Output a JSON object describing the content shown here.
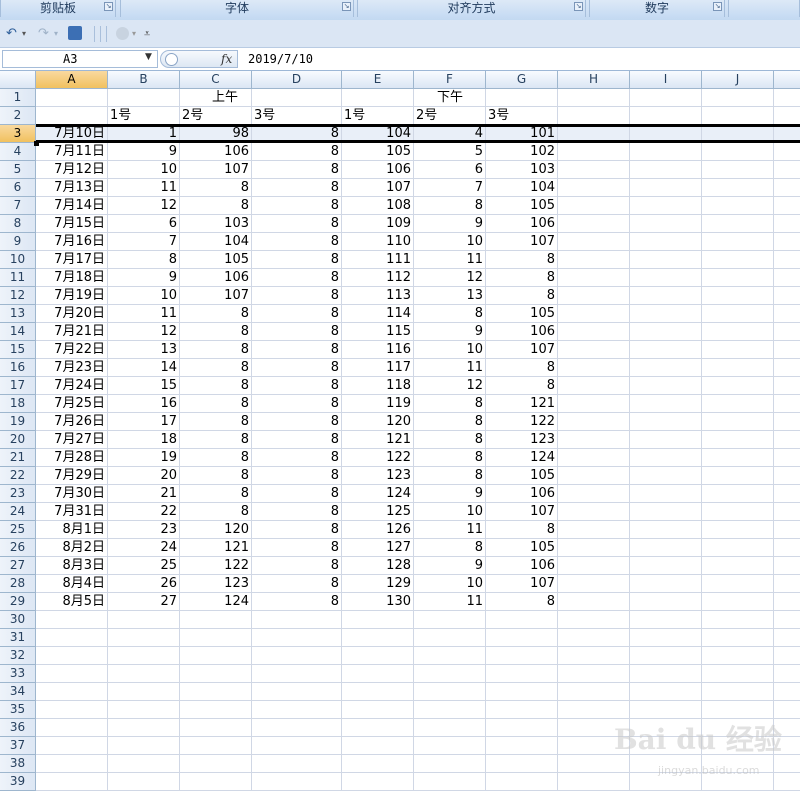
{
  "ribbon": {
    "groups": [
      {
        "label": "剪贴板"
      },
      {
        "label": "字体"
      },
      {
        "label": "对齐方式"
      },
      {
        "label": "数字"
      }
    ]
  },
  "qat": {
    "undo_icon": "undo-icon",
    "redo_icon": "redo-icon",
    "save_icon": "save-icon",
    "customize_icon": "customize-qat-icon"
  },
  "formula_bar": {
    "name_box": "A3",
    "fx_label": "fx",
    "content": "2019/7/10"
  },
  "columns": [
    "A",
    "B",
    "C",
    "D",
    "E",
    "F",
    "G",
    "H",
    "I",
    "J"
  ],
  "selected_column": "A",
  "selected_row": "3",
  "rows": [
    "1",
    "2",
    "3",
    "4",
    "5",
    "6",
    "7",
    "8",
    "9",
    "10",
    "11",
    "12",
    "13",
    "14",
    "15",
    "16",
    "17",
    "18",
    "19",
    "20",
    "21",
    "22",
    "23",
    "24",
    "25",
    "26",
    "27",
    "28",
    "29",
    "30",
    "31",
    "32",
    "33",
    "34",
    "35",
    "36",
    "37",
    "38",
    "39"
  ],
  "header": {
    "am": "上午",
    "pm": "下午",
    "sub": [
      "1号",
      "2号",
      "3号",
      "1号",
      "2号",
      "3号"
    ]
  },
  "table": [
    [
      "7月10日",
      "1",
      "98",
      "8",
      "104",
      "4",
      "101"
    ],
    [
      "7月11日",
      "9",
      "106",
      "8",
      "105",
      "5",
      "102"
    ],
    [
      "7月12日",
      "10",
      "107",
      "8",
      "106",
      "6",
      "103"
    ],
    [
      "7月13日",
      "11",
      "8",
      "8",
      "107",
      "7",
      "104"
    ],
    [
      "7月14日",
      "12",
      "8",
      "8",
      "108",
      "8",
      "105"
    ],
    [
      "7月15日",
      "6",
      "103",
      "8",
      "109",
      "9",
      "106"
    ],
    [
      "7月16日",
      "7",
      "104",
      "8",
      "110",
      "10",
      "107"
    ],
    [
      "7月17日",
      "8",
      "105",
      "8",
      "111",
      "11",
      "8"
    ],
    [
      "7月18日",
      "9",
      "106",
      "8",
      "112",
      "12",
      "8"
    ],
    [
      "7月19日",
      "10",
      "107",
      "8",
      "113",
      "13",
      "8"
    ],
    [
      "7月20日",
      "11",
      "8",
      "8",
      "114",
      "8",
      "105"
    ],
    [
      "7月21日",
      "12",
      "8",
      "8",
      "115",
      "9",
      "106"
    ],
    [
      "7月22日",
      "13",
      "8",
      "8",
      "116",
      "10",
      "107"
    ],
    [
      "7月23日",
      "14",
      "8",
      "8",
      "117",
      "11",
      "8"
    ],
    [
      "7月24日",
      "15",
      "8",
      "8",
      "118",
      "12",
      "8"
    ],
    [
      "7月25日",
      "16",
      "8",
      "8",
      "119",
      "8",
      "121"
    ],
    [
      "7月26日",
      "17",
      "8",
      "8",
      "120",
      "8",
      "122"
    ],
    [
      "7月27日",
      "18",
      "8",
      "8",
      "121",
      "8",
      "123"
    ],
    [
      "7月28日",
      "19",
      "8",
      "8",
      "122",
      "8",
      "124"
    ],
    [
      "7月29日",
      "20",
      "8",
      "8",
      "123",
      "8",
      "105"
    ],
    [
      "7月30日",
      "21",
      "8",
      "8",
      "124",
      "9",
      "106"
    ],
    [
      "7月31日",
      "22",
      "8",
      "8",
      "125",
      "10",
      "107"
    ],
    [
      "8月1日",
      "23",
      "120",
      "8",
      "126",
      "11",
      "8"
    ],
    [
      "8月2日",
      "24",
      "121",
      "8",
      "127",
      "8",
      "105"
    ],
    [
      "8月3日",
      "25",
      "122",
      "8",
      "128",
      "9",
      "106"
    ],
    [
      "8月4日",
      "26",
      "123",
      "8",
      "129",
      "10",
      "107"
    ],
    [
      "8月5日",
      "27",
      "124",
      "8",
      "130",
      "11",
      "8"
    ]
  ],
  "watermark": {
    "brand": "Bai du 经验",
    "url": "jingyan.baidu.com"
  },
  "colors": {
    "selection_header": "#f1c15f",
    "gridline": "#d0d7e5",
    "header_bg": "#dbe6f4"
  }
}
